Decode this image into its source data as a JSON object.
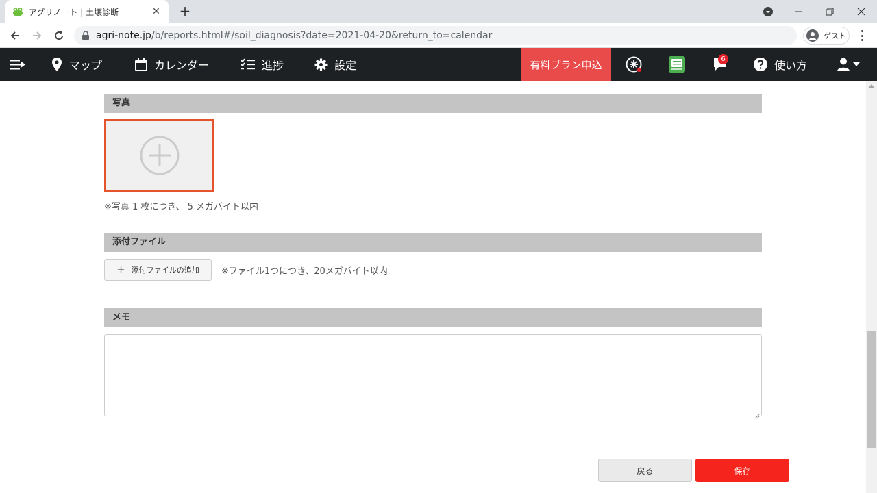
{
  "browser": {
    "tab_title": "アグリノート | 土壌診断",
    "tab_close": "✕",
    "new_tab": "+",
    "url_host": "agri-note.jp",
    "url_path": "/b/reports.html#/soil_diagnosis?date=2021-04-20&return_to=calendar",
    "profile_label": "ゲスト"
  },
  "appbar": {
    "nav": [
      {
        "label": "マップ",
        "icon": "map-pin-icon"
      },
      {
        "label": "カレンダー",
        "icon": "calendar-icon"
      },
      {
        "label": "進捗",
        "icon": "checklist-icon"
      },
      {
        "label": "設定",
        "icon": "gear-icon"
      }
    ],
    "paid_plan_label": "有料プラン申込",
    "notification_count": "6",
    "help_label": "使い方",
    "accent_color": "#e94b4b"
  },
  "photo_section": {
    "heading": "写真",
    "note": "※写真 1 枚につき、 5 メガバイト以内"
  },
  "attachment_section": {
    "heading": "添付ファイル",
    "add_button_label": "添付ファイルの追加",
    "note": "※ファイル1つにつき、20メガバイト以内"
  },
  "memo_section": {
    "heading": "メモ",
    "value": ""
  },
  "footer": {
    "back_label": "戻る",
    "save_label": "保存",
    "save_color": "#f5241c"
  }
}
